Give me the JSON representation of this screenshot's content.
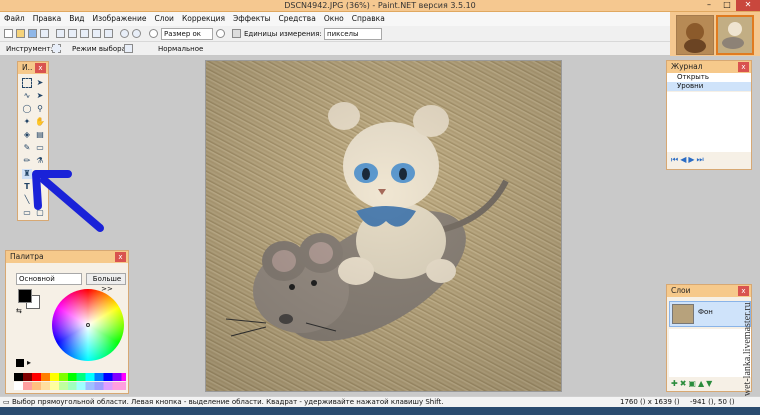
{
  "window": {
    "title": "DSCN4942.JPG (36%) - Paint.NET версия 3.5.10",
    "minimize": "–",
    "maximize": "□",
    "close": "✕"
  },
  "menu": [
    "Файл",
    "Правка",
    "Вид",
    "Изображение",
    "Слои",
    "Коррекция",
    "Эффекты",
    "Средства",
    "Окно",
    "Справка"
  ],
  "toolbar": {
    "zoom_value": "Размер ок",
    "units_label": "Единицы измерения:",
    "units_value": "пикселы",
    "instrument_label": "Инструмент:",
    "selection_mode_label": "Режим выбора:",
    "selection_mode_value": "Нормальное"
  },
  "tools_panel": {
    "title": "И..",
    "close": "x"
  },
  "palette": {
    "title": "Палитра",
    "close": "x",
    "mode": "Основной",
    "more_button": "Больше >>",
    "primary_color": "#000000",
    "secondary_color": "#ffffff"
  },
  "journal": {
    "title": "Журнал",
    "close": "x",
    "items": [
      "Открыть изображение",
      "Уровни"
    ]
  },
  "layers": {
    "title": "Слои",
    "close": "x",
    "layer_name": "Фон"
  },
  "status": {
    "message": "Выбор прямоугольной области. Левая кнопка - выделение области. Квадрат - удерживайте нажатой клавишу Shift.",
    "image_size": "1760 () x 1639 ()",
    "cursor": "-941 (), 50 ()"
  },
  "watermark": "swet-lanka.livemaster.ru",
  "colors": {
    "accent": "#f5c890",
    "arrow": "#1a22d8",
    "panel_header": "#f6c98b"
  }
}
